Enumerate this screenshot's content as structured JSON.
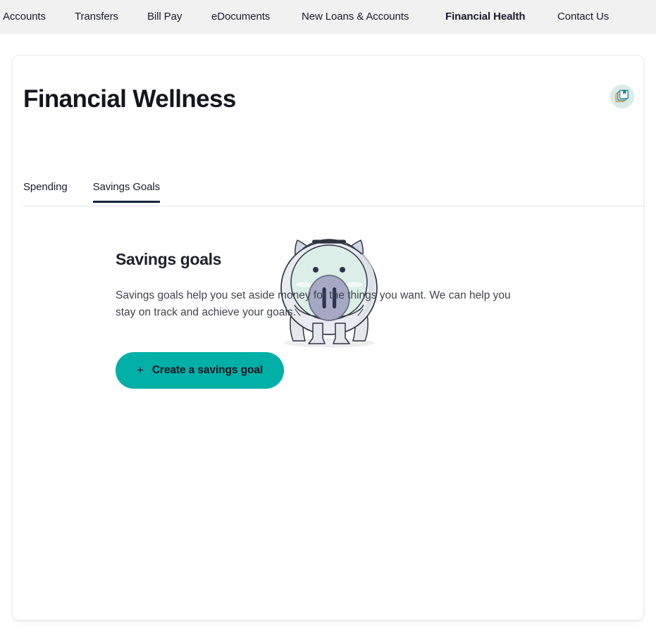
{
  "nav": {
    "items": [
      {
        "label": "Accounts",
        "active": false
      },
      {
        "label": "Transfers",
        "active": false
      },
      {
        "label": "Bill Pay",
        "active": false
      },
      {
        "label": "eDocuments",
        "active": false
      },
      {
        "label": "New Loans & Accounts",
        "active": false
      },
      {
        "label": "Financial Health",
        "active": true
      },
      {
        "label": "Contact Us",
        "active": false
      }
    ]
  },
  "page": {
    "title": "Financial Wellness",
    "action_icon": "library-books-icon"
  },
  "tabs": [
    {
      "label": "Spending",
      "active": false
    },
    {
      "label": "Savings Goals",
      "active": true
    }
  ],
  "empty_state": {
    "illustration": "piggy-bank-illustration",
    "heading": "Savings goals",
    "body": "Savings goals help you set aside money for the things you want. We can help you stay on track and achieve your goals.",
    "cta_icon": "plus-icon",
    "cta_label": "Create a savings goal"
  },
  "colors": {
    "accent_teal": "#00b0a6",
    "icon_circle_bg": "#d8ebe8",
    "icon_stroke": "#147f86",
    "nav_bg": "#f1f1f1",
    "active_tab_underline": "#15253c",
    "text_dark": "#15151f",
    "text_body": "#3e4550"
  }
}
